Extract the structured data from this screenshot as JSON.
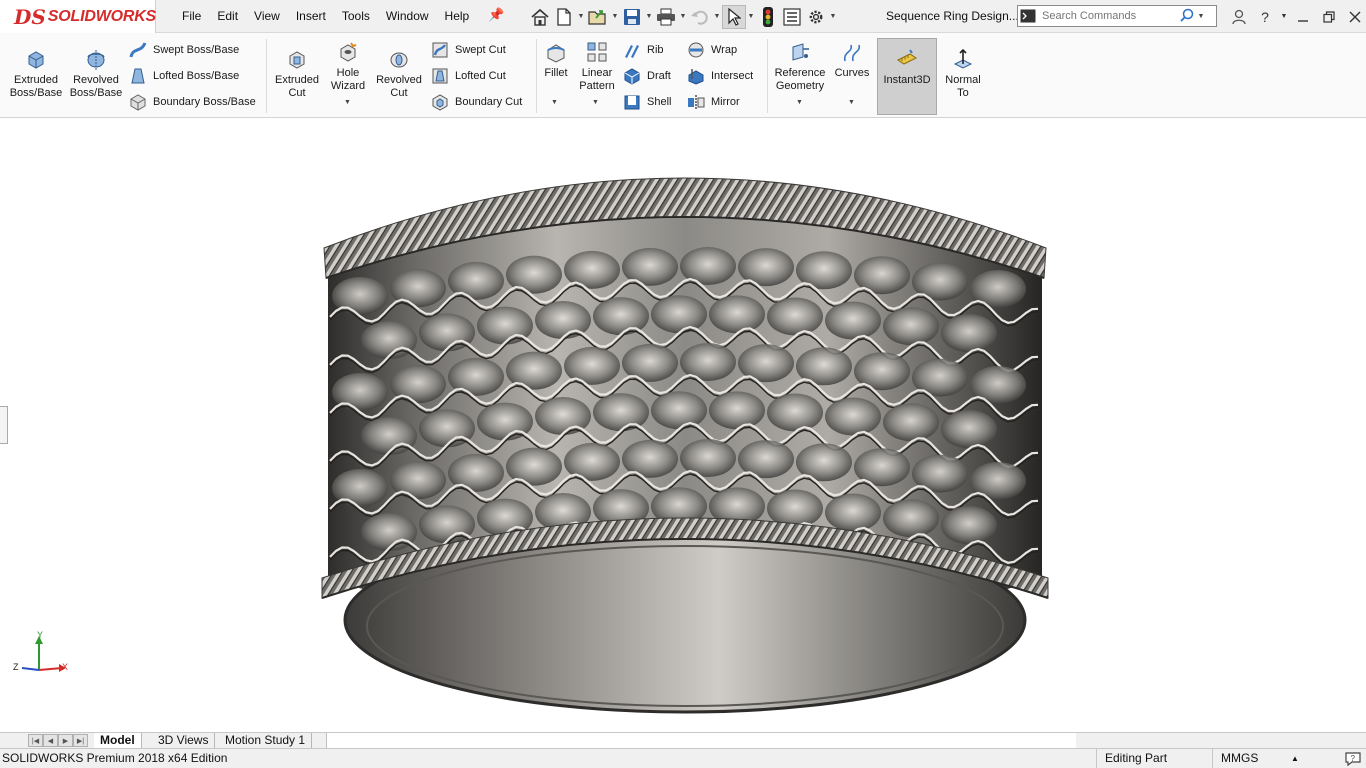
{
  "app": {
    "logo_mark": "DS",
    "logo_text": "SOLIDWORKS",
    "document_title": "Sequence Ring Design..."
  },
  "menu": [
    "File",
    "Edit",
    "View",
    "Insert",
    "Tools",
    "Window",
    "Help"
  ],
  "quick_access_icons": [
    "home-icon",
    "new-document-icon",
    "open-icon",
    "save-icon",
    "print-icon",
    "undo-icon",
    "select-cursor-icon",
    "rebuild-traffic-light-icon",
    "file-properties-icon",
    "options-gear-icon"
  ],
  "search": {
    "placeholder": "Search Commands"
  },
  "ribbon": {
    "extruded_boss": "Extruded\nBoss/Base",
    "revolved_boss": "Revolved\nBoss/Base",
    "swept_boss": "Swept Boss/Base",
    "lofted_boss": "Lofted Boss/Base",
    "boundary_boss": "Boundary Boss/Base",
    "extruded_cut": "Extruded\nCut",
    "hole_wizard": "Hole\nWizard",
    "revolved_cut": "Revolved\nCut",
    "swept_cut": "Swept Cut",
    "lofted_cut": "Lofted Cut",
    "boundary_cut": "Boundary Cut",
    "fillet": "Fillet",
    "linear_pattern": "Linear\nPattern",
    "rib": "Rib",
    "draft": "Draft",
    "shell": "Shell",
    "wrap": "Wrap",
    "intersect": "Intersect",
    "mirror": "Mirror",
    "reference_geometry": "Reference\nGeometry",
    "curves": "Curves",
    "instant3d": "Instant3D",
    "normal_to": "Normal\nTo"
  },
  "triad": {
    "y": "Y",
    "z": "Z",
    "x": "X"
  },
  "tabs": {
    "model": "Model",
    "views_3d": "3D Views",
    "motion_study": "Motion Study 1"
  },
  "status": {
    "product": "SOLIDWORKS Premium 2018 x64 Edition",
    "mode": "Editing Part",
    "units": "MMGS"
  },
  "colors": {
    "brand_red": "#d62b2b",
    "accent_blue": "#2a6fc9",
    "ring_metal": "#7d7b78"
  }
}
